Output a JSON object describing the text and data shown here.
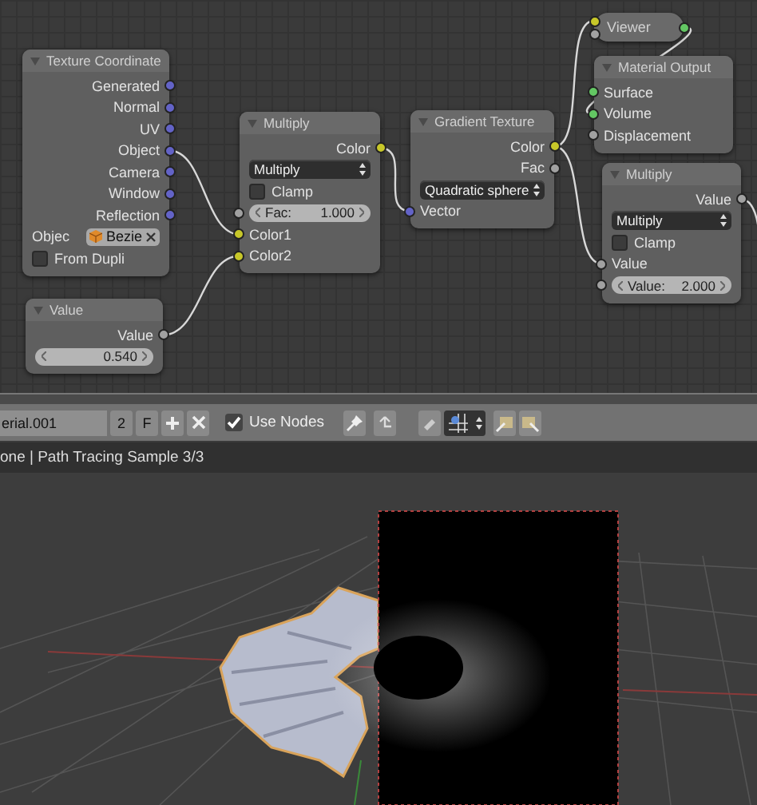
{
  "node_editor": {
    "nodes": [
      {
        "title": "Texture Coordinate",
        "collapsed": false,
        "rows": [
          {
            "kind": "output",
            "label": "Generated",
            "color": "#6363c7"
          },
          {
            "kind": "output",
            "label": "Normal",
            "color": "#6363c7"
          },
          {
            "kind": "output",
            "label": "UV",
            "color": "#6363c7"
          },
          {
            "kind": "output",
            "label": "Object",
            "color": "#6363c7"
          },
          {
            "kind": "output",
            "label": "Camera",
            "color": "#6363c7"
          },
          {
            "kind": "output",
            "label": "Window",
            "color": "#6363c7"
          },
          {
            "kind": "output",
            "label": "Reflection",
            "color": "#6363c7"
          },
          {
            "kind": "object",
            "label": "Objec",
            "value": "Bezie"
          },
          {
            "kind": "checkbox",
            "label": "From Dupli",
            "checked": false
          }
        ]
      },
      {
        "title": "Value",
        "collapsed": false,
        "rows": [
          {
            "kind": "output",
            "label": "Value",
            "color": "#a1a1a1"
          },
          {
            "kind": "field",
            "value": "0.540"
          }
        ]
      },
      {
        "title": "Multiply",
        "collapsed": false,
        "rows": [
          {
            "kind": "output",
            "label": "Color",
            "color": "#c7c729"
          },
          {
            "kind": "dropdown",
            "value": "Multiply"
          },
          {
            "kind": "checkbox",
            "label": "Clamp",
            "checked": false
          },
          {
            "kind": "field",
            "label": "Fac:",
            "value": "1.000",
            "color": "#a1a1a1"
          },
          {
            "kind": "input",
            "label": "Color1",
            "color": "#c7c729"
          },
          {
            "kind": "input",
            "label": "Color2",
            "color": "#c7c729"
          }
        ]
      },
      {
        "title": "Gradient Texture",
        "collapsed": false,
        "rows": [
          {
            "kind": "output",
            "label": "Color",
            "color": "#c7c729"
          },
          {
            "kind": "output",
            "label": "Fac",
            "color": "#a1a1a1"
          },
          {
            "kind": "dropdown",
            "value": "Quadratic sphere"
          },
          {
            "kind": "input",
            "label": "Vector",
            "color": "#6363c7"
          }
        ]
      },
      {
        "title": "Viewer",
        "collapsed": true,
        "sockets": [
          {
            "kind": "input",
            "color": "#c7c729"
          },
          {
            "kind": "input",
            "color": "#a1a1a1"
          },
          {
            "kind": "output",
            "color": "#63c763"
          }
        ]
      },
      {
        "title": "Material Output",
        "collapsed": false,
        "rows": [
          {
            "kind": "input",
            "label": "Surface",
            "color": "#63c763"
          },
          {
            "kind": "input",
            "label": "Volume",
            "color": "#63c763"
          },
          {
            "kind": "input",
            "label": "Displacement",
            "color": "#a1a1a1"
          }
        ]
      },
      {
        "title": "Multiply",
        "collapsed": false,
        "rows": [
          {
            "kind": "output",
            "label": "Value",
            "color": "#a1a1a1"
          },
          {
            "kind": "dropdown",
            "value": "Multiply"
          },
          {
            "kind": "checkbox",
            "label": "Clamp",
            "checked": false
          },
          {
            "kind": "input",
            "label": "Value",
            "color": "#a1a1a1"
          },
          {
            "kind": "field",
            "label": "Value:",
            "value": "2.000",
            "color": "#a1a1a1"
          }
        ]
      }
    ]
  },
  "header": {
    "material": "erial.001",
    "users": "2",
    "fake_user": "F",
    "use_nodes": {
      "label": "Use Nodes",
      "checked": true
    }
  },
  "info": "one | Path Tracing Sample 3/3"
}
